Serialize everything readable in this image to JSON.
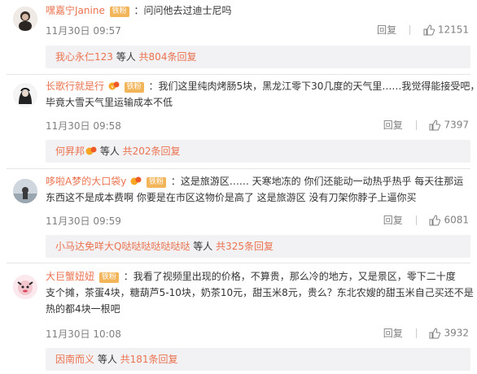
{
  "comments": [
    {
      "user": "嘿嘉宁Janine",
      "badge": "铁粉",
      "text_lines": [
        "：问问他去过迪士尼吗"
      ],
      "time": "11月30日 09:57",
      "reply_label": "回复",
      "likes": "12151",
      "reply_summary": {
        "name": "我心永仁123",
        "middle": " 等人 ",
        "count": "共804条回复"
      }
    },
    {
      "user": "长歌行就是行",
      "badge": "铁粉",
      "text_lines": [
        "：我们这里纯肉烤肠5块，黑龙江零下30几度的天气里……我觉得能接受吧，",
        "毕竟大雪天气里运输成本不低"
      ],
      "time": "11月30日 09:58",
      "reply_label": "回复",
      "likes": "7397",
      "reply_summary": {
        "name": "何昇邦",
        "middle": " 等人 ",
        "count": "共202条回复"
      }
    },
    {
      "user": "哆啦A梦的大口袋y",
      "badge": "铁粉",
      "text_lines": [
        "：这是旅游区…… 天寒地冻的 你们还能动一动热乎热乎 每天往那运",
        "东西这不是成本费啊 你要是在市区这物价是高了 这是旅游区 没有刀架你脖子上逼你买"
      ],
      "time": "11月30日 09:59",
      "reply_label": "回复",
      "likes": "6081",
      "reply_summary": {
        "name": "小马达免咩大Q哒哒哒哒哒哒哒",
        "middle": " 等人 ",
        "count": "共325条回复"
      }
    },
    {
      "user": "大巨蟹妞妞",
      "badge": "铁粉",
      "text_lines": [
        "：我看了视频里出现的价格，不算贵，那么冷的地方，又是景区，零下二十度",
        "支个摊，茶蛋4块，糖葫芦5-10块，奶茶10元，甜玉米8元，贵么？东北农嫂的甜玉米自己买还不是",
        "热的都4块一根吧"
      ],
      "time": "11月30日 10:08",
      "reply_label": "回复",
      "likes": "3932",
      "reply_summary": {
        "name": "因南而义",
        "middle": " 等人 ",
        "count": "共181条回复"
      }
    }
  ]
}
